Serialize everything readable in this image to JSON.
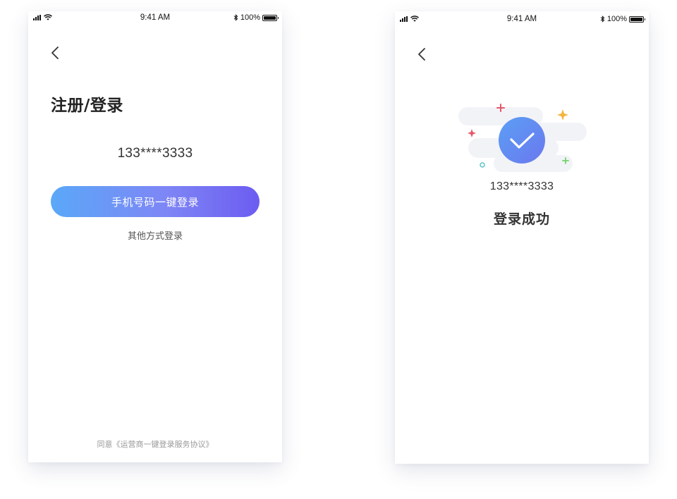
{
  "screens": {
    "login": {
      "status_bar": {
        "time": "9:41 AM",
        "battery_text": "100%"
      },
      "title": "注册/登录",
      "masked_phone": "133****3333",
      "primary_button": "手机号码一键登录",
      "secondary_link": "其他方式登录",
      "agreement_text": "同意《运营商一键登录服务协议》"
    },
    "success": {
      "status_bar": {
        "time": "9:41 AM",
        "battery_text": "100%"
      },
      "masked_phone": "133****3333",
      "message": "登录成功"
    }
  },
  "colors": {
    "button_gradient_start": "#5aa8f8",
    "button_gradient_end": "#6c5cf1",
    "check_circle": "#6b86f0",
    "sparkle_red": "#e5576a",
    "sparkle_orange": "#f5b53c",
    "sparkle_green": "#6fd36b",
    "ring_teal": "#5cc4c9"
  },
  "icons": [
    "signal-icon",
    "wifi-icon",
    "bluetooth-icon",
    "battery-icon",
    "back-arrow-icon",
    "checkmark-icon"
  ]
}
